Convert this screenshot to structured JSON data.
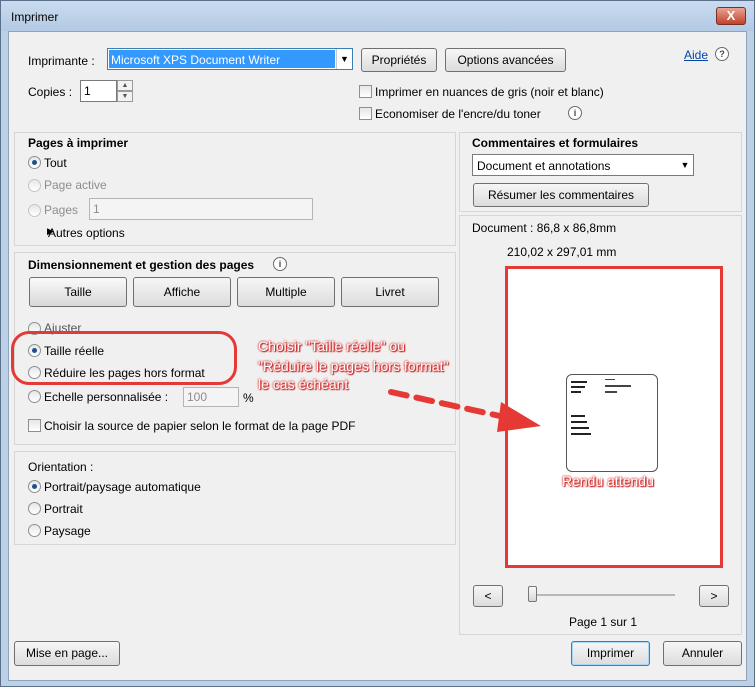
{
  "window": {
    "title": "Imprimer",
    "close": "X"
  },
  "printer": {
    "label": "Imprimante :",
    "selected": "Microsoft XPS Document Writer",
    "properties": "Propriétés",
    "advanced": "Options avancées",
    "help": "Aide",
    "help_icon": "?"
  },
  "copies": {
    "label": "Copies :",
    "value": "1"
  },
  "options": {
    "grayscale": "Imprimer en nuances de gris (noir et blanc)",
    "save_ink": "Economiser de l'encre/du toner"
  },
  "pages": {
    "heading": "Pages à imprimer",
    "all": "Tout",
    "current": "Page active",
    "pages": "Pages",
    "pages_value": "1",
    "more": "Autres options"
  },
  "sizing": {
    "heading": "Dimensionnement et gestion des pages",
    "tabs": [
      "Taille",
      "Affiche",
      "Multiple",
      "Livret"
    ],
    "fit": "Ajuster",
    "actual": "Taille réelle",
    "shrink": "Réduire les pages hors format",
    "custom": "Echelle personnalisée :",
    "custom_value": "100",
    "percent": "%",
    "paper_source": "Choisir la source de papier selon le format de la page PDF"
  },
  "orientation": {
    "heading": "Orientation :",
    "auto": "Portrait/paysage automatique",
    "portrait": "Portrait",
    "landscape": "Paysage"
  },
  "comments": {
    "heading": "Commentaires et formulaires",
    "selected": "Document et annotations",
    "summarize": "Résumer les commentaires"
  },
  "preview": {
    "doc_size": "Document : 86,8 x 86,8mm",
    "paper_size": "210,02 x 297,01 mm",
    "prev": "<",
    "next": ">",
    "page_info": "Page 1 sur 1"
  },
  "annotation": {
    "callout_line1": "Choisir \"Taille réelle\" ou",
    "callout_line2": "\"Réduire le pages hors format\"",
    "callout_line3": "le cas échéant",
    "expected": "Rendu attendu",
    "accent": "#e53935"
  },
  "footer": {
    "page_setup": "Mise en page...",
    "print": "Imprimer",
    "cancel": "Annuler"
  }
}
